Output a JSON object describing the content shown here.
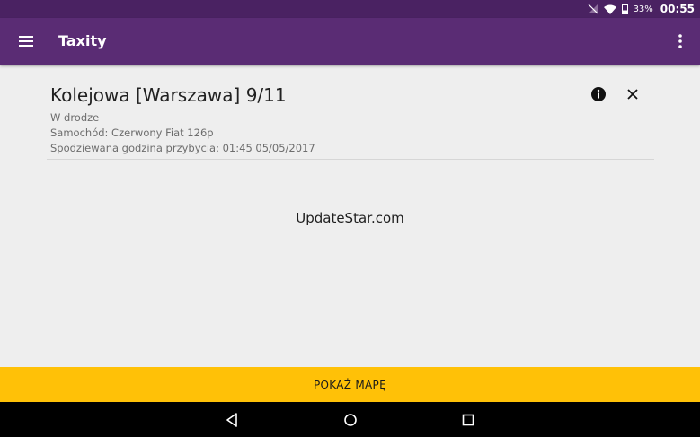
{
  "status_bar": {
    "battery": "33%",
    "time": "00:55",
    "icons": [
      "signal-off-icon",
      "wifi-icon",
      "battery-icon"
    ]
  },
  "app_bar": {
    "title": "Taxity",
    "left_icon": "menu-icon",
    "right_icon": "overflow-menu-icon"
  },
  "order": {
    "address": "Kolejowa [Warszawa] 9/11",
    "status": "W drodze",
    "car": "Samochód: Czerwony Fiat 126p",
    "eta": "Spodziewana godzina przybycia: 01:45 05/05/2017",
    "actions": [
      "info-icon",
      "close-icon"
    ]
  },
  "watermark": "UpdateStar.com",
  "bottom_button": {
    "label": "POKAŻ MAPĘ",
    "color": "#ffc107"
  },
  "nav_bar": {
    "icons": [
      "back-icon",
      "home-icon",
      "recents-icon"
    ]
  },
  "colors": {
    "status_bar": "#4a2262",
    "app_bar": "#5a2c74",
    "background": "#eeeeee"
  }
}
